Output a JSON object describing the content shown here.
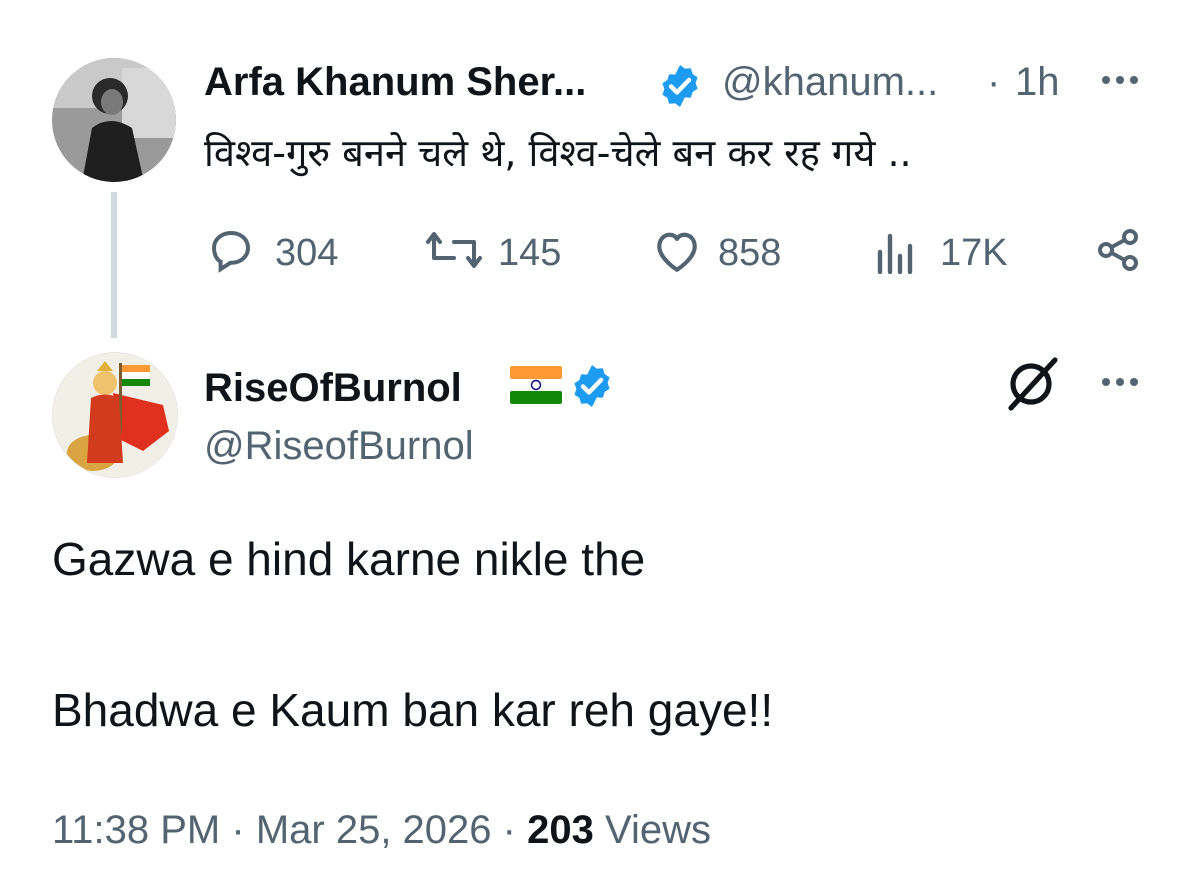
{
  "parent_tweet": {
    "author_name": "Arfa Khanum Sher...",
    "handle": "@khanum...",
    "separator": "·",
    "time": "1h",
    "text": "विश्व-गुरु बनने चले थे, विश्व-चेले बन कर रह गये ..",
    "replies": "304",
    "reposts": "145",
    "likes": "858",
    "views": "17K",
    "verified": true
  },
  "reply_tweet": {
    "author_name": "RiseOfBurnol",
    "handle": "@RiseofBurnol",
    "verified": true,
    "line1": "Gazwa e hind karne nikle the",
    "line2": "Bhadwa e Kaum ban kar reh gaye!!",
    "time": "11:38 PM",
    "dot1": "·",
    "date": "Mar 25, 2026",
    "dot2": "·",
    "views_count": "203",
    "views_label": "Views"
  },
  "colors": {
    "verified_blue": "#1d9bf0",
    "text_primary": "#0f1419",
    "text_secondary": "#536471",
    "thread_line": "#cfd9de"
  },
  "icons": [
    "reply-icon",
    "repost-icon",
    "like-icon",
    "views-icon",
    "share-icon",
    "grok-icon",
    "more-icon",
    "verified-icon",
    "india-flag-icon"
  ]
}
